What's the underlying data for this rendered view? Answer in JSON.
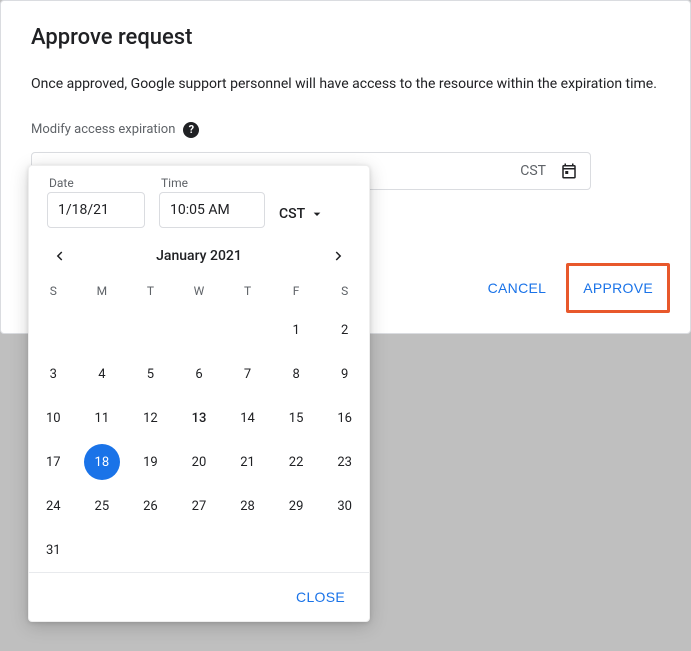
{
  "modal": {
    "title": "Approve request",
    "description": "Once approved, Google support personnel will have access to the resource within the expiration time.",
    "modify_label": "Modify access expiration",
    "tz_display": "CST",
    "cancel": "CANCEL",
    "approve": "APPROVE"
  },
  "picker": {
    "date_label": "Date",
    "date_value": "1/18/21",
    "time_label": "Time",
    "time_value": "10:05 AM",
    "tz": "CST",
    "month_title": "January 2021",
    "weekdays": [
      "S",
      "M",
      "T",
      "W",
      "T",
      "F",
      "S"
    ],
    "weeks": [
      [
        "",
        "",
        "",
        "",
        "",
        "1",
        "2"
      ],
      [
        "3",
        "4",
        "5",
        "6",
        "7",
        "8",
        "9"
      ],
      [
        "10",
        "11",
        "12",
        "13",
        "14",
        "15",
        "16"
      ],
      [
        "17",
        "18",
        "19",
        "20",
        "21",
        "22",
        "23"
      ],
      [
        "24",
        "25",
        "26",
        "27",
        "28",
        "29",
        "30"
      ],
      [
        "31",
        "",
        "",
        "",
        "",
        "",
        ""
      ]
    ],
    "today": "13",
    "selected": "18",
    "close": "CLOSE"
  }
}
